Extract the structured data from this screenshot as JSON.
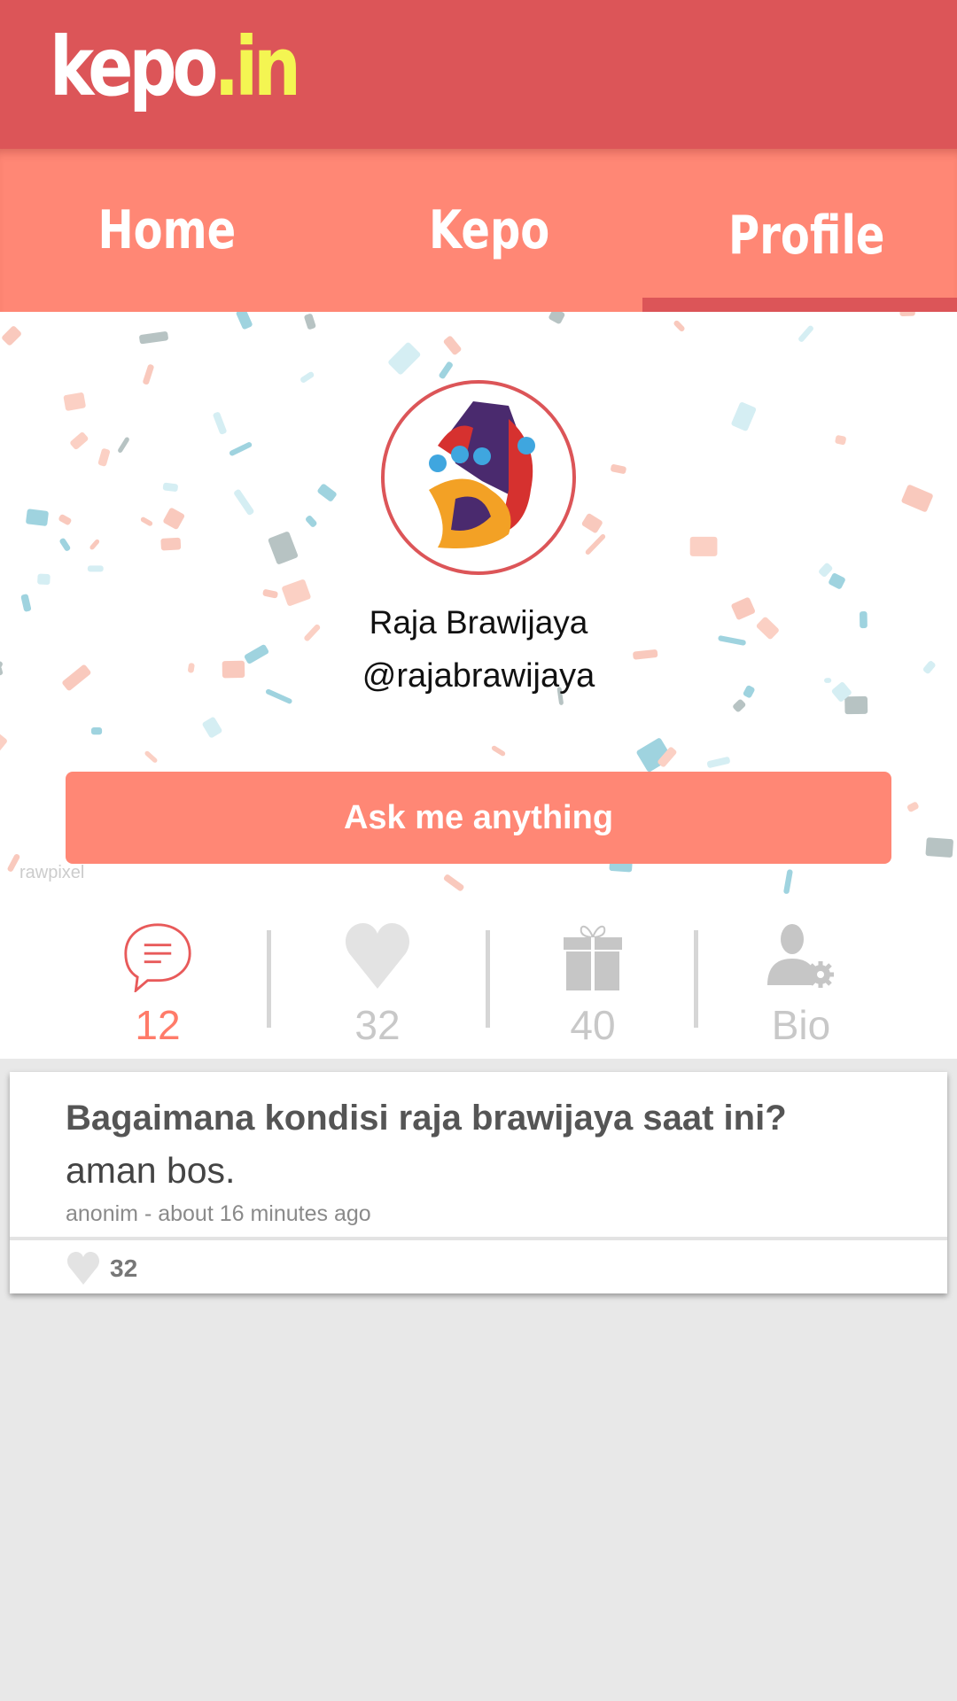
{
  "app": {
    "logo_main": "kepo",
    "logo_tld": ".in"
  },
  "tabs": [
    {
      "label": "Home",
      "active": false
    },
    {
      "label": "Kepo",
      "active": false
    },
    {
      "label": "Profile",
      "active": true
    }
  ],
  "profile": {
    "name": "Raja Brawijaya",
    "handle": "@rajabrawijaya",
    "ask_button": "Ask me anything",
    "watermark": "rawpixel"
  },
  "stats": [
    {
      "icon": "speech-bubble-icon",
      "value": "12",
      "active": true
    },
    {
      "icon": "heart-icon",
      "value": "32",
      "active": false
    },
    {
      "icon": "gift-icon",
      "value": "40",
      "active": false
    },
    {
      "icon": "user-settings-icon",
      "value": "Bio",
      "active": false
    }
  ],
  "posts": [
    {
      "question": "Bagaimana kondisi raja brawijaya saat ini?",
      "answer": "aman bos.",
      "meta": "anonim - about 16 minutes ago",
      "likes": "32"
    }
  ],
  "colors": {
    "header": "#dc5558",
    "tabbar": "#ff8775",
    "accent": "#ff7b69",
    "logo_tld": "#f4f552"
  }
}
